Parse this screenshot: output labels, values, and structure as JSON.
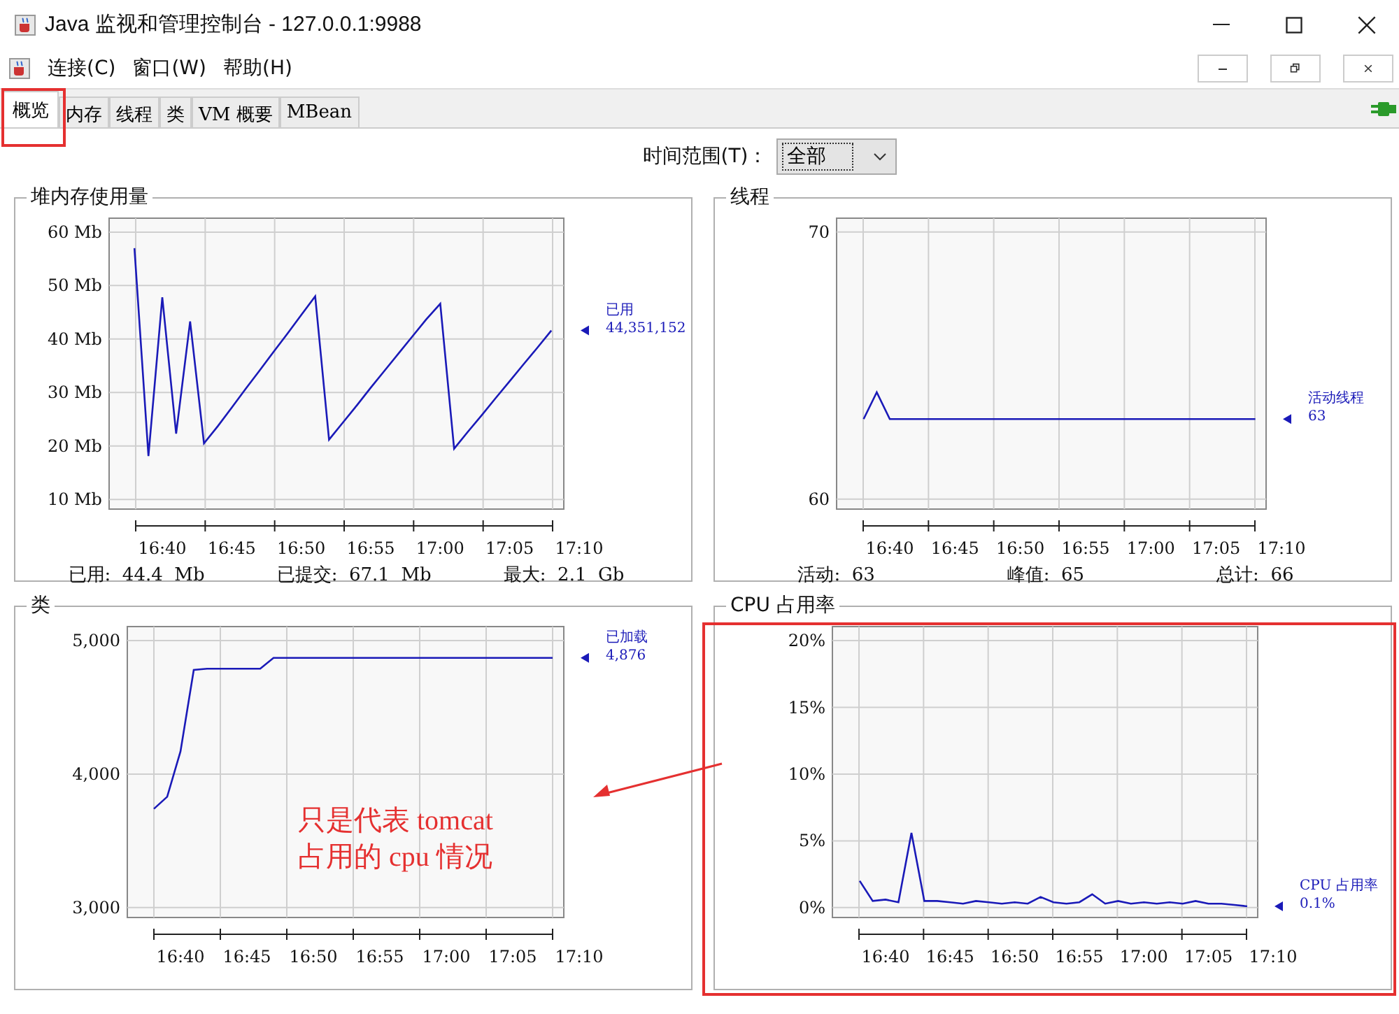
{
  "window": {
    "title": "Java 监视和管理控制台 - 127.0.0.1:9988"
  },
  "menu": [
    "连接(C)",
    "窗口(W)",
    "帮助(H)"
  ],
  "tabs": [
    {
      "label": "概览",
      "selected": true
    },
    {
      "label": "内存",
      "selected": false
    },
    {
      "label": "线程",
      "selected": false
    },
    {
      "label": "类",
      "selected": false
    },
    {
      "label": "VM 概要",
      "selected": false
    },
    {
      "label": "MBean",
      "selected": false
    }
  ],
  "time_range": {
    "label": "时间范围(T)：",
    "value": "全部"
  },
  "panels": [
    {
      "title": "堆内存使用量",
      "legend_value": "44,351,152",
      "stats": [
        {
          "label": "已用:",
          "value": "44.4  Mb"
        },
        {
          "label": "已提交:",
          "value": "67.1  Mb"
        },
        {
          "label": "最大:",
          "value": "2.1  Gb"
        }
      ],
      "chart_data": {
        "type": "line",
        "grid": true,
        "categories": [
          null,
          null,
          "16:40",
          null,
          null,
          null,
          null,
          "16:45",
          null,
          null,
          null,
          null,
          "16:50",
          null,
          null,
          null,
          null,
          "16:55",
          null,
          null,
          null,
          null,
          "17:00",
          null,
          null,
          null,
          null,
          "17:05",
          null,
          null,
          null,
          null,
          "17:10"
        ],
        "series": [
          {
            "name": "已用",
            "color": "#1a1ab8",
            "values": [
              57.0,
              18.1,
              47.8,
              22.3,
              43.3,
              20.5,
              23.7,
              27.2,
              30.7,
              34.1,
              37.6,
              41.0,
              44.5,
              48.0,
              21.2,
              24.4,
              27.6,
              30.9,
              34.1,
              37.3,
              40.5,
              43.7,
              46.6,
              19.5,
              22.7,
              25.8,
              29.0,
              32.1,
              35.3,
              38.4,
              41.6,
              null,
              null
            ]
          }
        ],
        "ylim": [
          8.2,
          62.6
        ],
        "yticks": [
          {
            "value": 10,
            "label": "10 Mb"
          },
          {
            "value": 20,
            "label": "20 Mb"
          },
          {
            "value": 30,
            "label": "30 Mb"
          },
          {
            "value": 40,
            "label": "40 Mb"
          },
          {
            "value": 50,
            "label": "50 Mb"
          },
          {
            "value": 60,
            "label": "60 Mb"
          }
        ]
      }
    },
    {
      "title": "线程",
      "legend_value": "63",
      "stats": [
        {
          "label": "活动:",
          "value": "63"
        },
        {
          "label": "峰值:",
          "value": "65"
        },
        {
          "label": "总计:",
          "value": "66"
        }
      ],
      "chart_data": {
        "type": "line",
        "grid": true,
        "categories": [
          null,
          null,
          "16:40",
          null,
          null,
          null,
          null,
          "16:45",
          null,
          null,
          null,
          null,
          "16:50",
          null,
          null,
          null,
          null,
          "16:55",
          null,
          null,
          null,
          null,
          "17:00",
          null,
          null,
          null,
          null,
          "17:05",
          null,
          null,
          null,
          null,
          "17:10"
        ],
        "series": [
          {
            "name": "活动线程",
            "color": "#1a1ab8",
            "values": [
              63,
              64,
              63,
              63,
              63,
              63,
              63,
              63,
              63,
              63,
              63,
              63,
              63,
              63,
              63,
              63,
              63,
              63,
              63,
              63,
              63,
              63,
              63,
              63,
              63,
              63,
              63,
              63,
              63,
              63,
              63,
              null,
              null
            ]
          }
        ],
        "ylim": [
          59.63,
          70.52
        ],
        "yticks": [
          60,
          70
        ]
      }
    },
    {
      "title": "类",
      "legend_value": "4,876",
      "chart_data": {
        "type": "line",
        "grid": true,
        "categories": [
          null,
          null,
          "16:40",
          null,
          null,
          null,
          null,
          "16:45",
          null,
          null,
          null,
          null,
          "16:50",
          null,
          null,
          null,
          null,
          "16:55",
          null,
          null,
          null,
          null,
          "17:00",
          null,
          null,
          null,
          null,
          "17:05",
          null,
          null,
          null,
          null,
          "17:10"
        ],
        "series": [
          {
            "name": "已加载",
            "color": "#1a1ab8",
            "values": [
              3740,
              3830,
              4170,
              4780,
              4790,
              4790,
              4790,
              4790,
              4790,
              4870,
              4870,
              4870,
              4870,
              4870,
              4870,
              4870,
              4870,
              4870,
              4870,
              4870,
              4870,
              4870,
              4870,
              4870,
              4870,
              4870,
              4870,
              4870,
              4870,
              4870,
              4870,
              null,
              null
            ]
          }
        ],
        "ylim": [
          2926,
          5105
        ],
        "yticks": [
          {
            "value": 3000,
            "label": "3,000"
          },
          {
            "value": 4000,
            "label": "4,000"
          },
          {
            "value": 5000,
            "label": "5,000"
          }
        ]
      }
    },
    {
      "title": "CPU 占用率",
      "legend_value": "0.1%",
      "chart_data": {
        "type": "line",
        "grid": true,
        "categories": [
          null,
          null,
          "16:40",
          null,
          null,
          null,
          null,
          "16:45",
          null,
          null,
          null,
          null,
          "16:50",
          null,
          null,
          null,
          null,
          "16:55",
          null,
          null,
          null,
          null,
          "17:00",
          null,
          null,
          null,
          null,
          "17:05",
          null,
          null,
          null,
          null,
          "17:10"
        ],
        "series": [
          {
            "name": "CPU 占用率",
            "color": "#1a1ab8",
            "values": [
              2.0,
              0.5,
              0.6,
              0.4,
              5.6,
              0.5,
              0.5,
              0.4,
              0.3,
              0.5,
              0.4,
              0.3,
              0.4,
              0.3,
              0.8,
              0.4,
              0.3,
              0.4,
              1.0,
              0.3,
              0.5,
              0.3,
              0.4,
              0.3,
              0.4,
              0.3,
              0.5,
              0.3,
              0.3,
              0.2,
              0.1,
              null,
              null
            ]
          }
        ],
        "ylim": [
          -0.74,
          21.05
        ],
        "yticks": [
          {
            "value": 0,
            "label": "0%"
          },
          {
            "value": 5,
            "label": "5%"
          },
          {
            "value": 10,
            "label": "10%"
          },
          {
            "value": 15,
            "label": "15%"
          },
          {
            "value": 20,
            "label": "20%"
          }
        ]
      }
    }
  ],
  "annotation": {
    "text": "只是代表 tomcat\n占用的 cpu 情况"
  }
}
